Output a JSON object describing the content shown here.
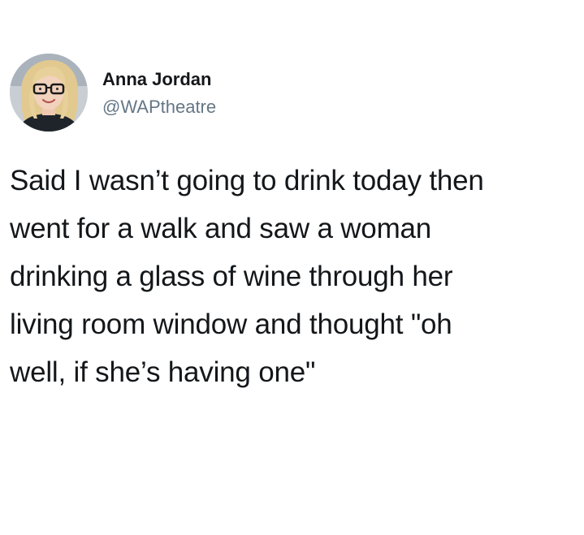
{
  "author": {
    "display_name": "Anna Jordan",
    "handle": "@WAPtheatre",
    "avatar_icon": "user-avatar-icon"
  },
  "tweet": {
    "lines": [
      "Said I wasn’t going to drink today then",
      "went for a walk and saw a woman",
      "drinking a glass of wine through her",
      "living room window and thought \"oh",
      "well, if she’s having one\""
    ]
  },
  "colors": {
    "background": "#ffffff",
    "text_primary": "#14171a",
    "text_secondary": "#657786"
  }
}
